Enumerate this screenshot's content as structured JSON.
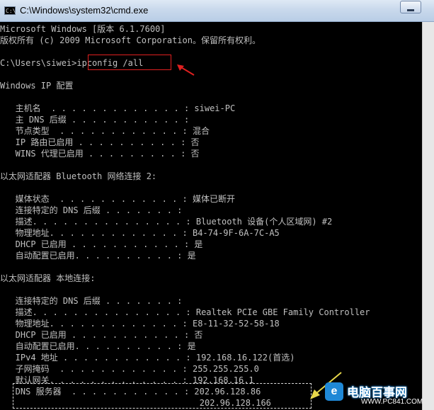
{
  "window": {
    "title": "C:\\Windows\\system32\\cmd.exe",
    "icon_text": "C:\\."
  },
  "console": {
    "lines": [
      "Microsoft Windows [版本 6.1.7600]",
      "版权所有 (c) 2009 Microsoft Corporation。保留所有权利。",
      "",
      "C:\\Users\\siwei>ipconfig /all",
      "",
      "Windows IP 配置",
      "",
      "   主机名  . . . . . . . . . . . . . : siwei-PC",
      "   主 DNS 后缀 . . . . . . . . . . . :",
      "   节点类型  . . . . . . . . . . . . : 混合",
      "   IP 路由已启用 . . . . . . . . . . : 否",
      "   WINS 代理已启用 . . . . . . . . . : 否",
      "",
      "以太网适配器 Bluetooth 网络连接 2:",
      "",
      "   媒体状态  . . . . . . . . . . . . : 媒体已断开",
      "   连接特定的 DNS 后缀 . . . . . . . :",
      "   描述. . . . . . . . . . . . . . . : Bluetooth 设备(个人区域网) #2",
      "   物理地址. . . . . . . . . . . . . : B4-74-9F-6A-7C-A5",
      "   DHCP 已启用 . . . . . . . . . . . : 是",
      "   自动配置已启用. . . . . . . . . . : 是",
      "",
      "以太网适配器 本地连接:",
      "",
      "   连接特定的 DNS 后缀 . . . . . . . :",
      "   描述. . . . . . . . . . . . . . . : Realtek PCIe GBE Family Controller",
      "   物理地址. . . . . . . . . . . . . : E8-11-32-52-58-18",
      "   DHCP 已启用 . . . . . . . . . . . : 否",
      "   自动配置已启用. . . . . . . . . . : 是",
      "   IPv4 地址 . . . . . . . . . . . . : 192.168.16.122(首选)",
      "   子网掩码  . . . . . . . . . . . . : 255.255.255.0",
      "   默认网关. . . . . . . . . . . . . : 192.168.16.1",
      "   DNS 服务器  . . . . . . . . . . . : 202.96.128.86",
      "                                       202.96.128.166"
    ]
  },
  "watermark": {
    "logo": "e",
    "title": "电脑百事网",
    "url": "WWW.PC841.COM"
  },
  "colors": {
    "console_bg": "#000000",
    "console_text": "#c0c0c0",
    "highlight_box": "#e02020"
  }
}
